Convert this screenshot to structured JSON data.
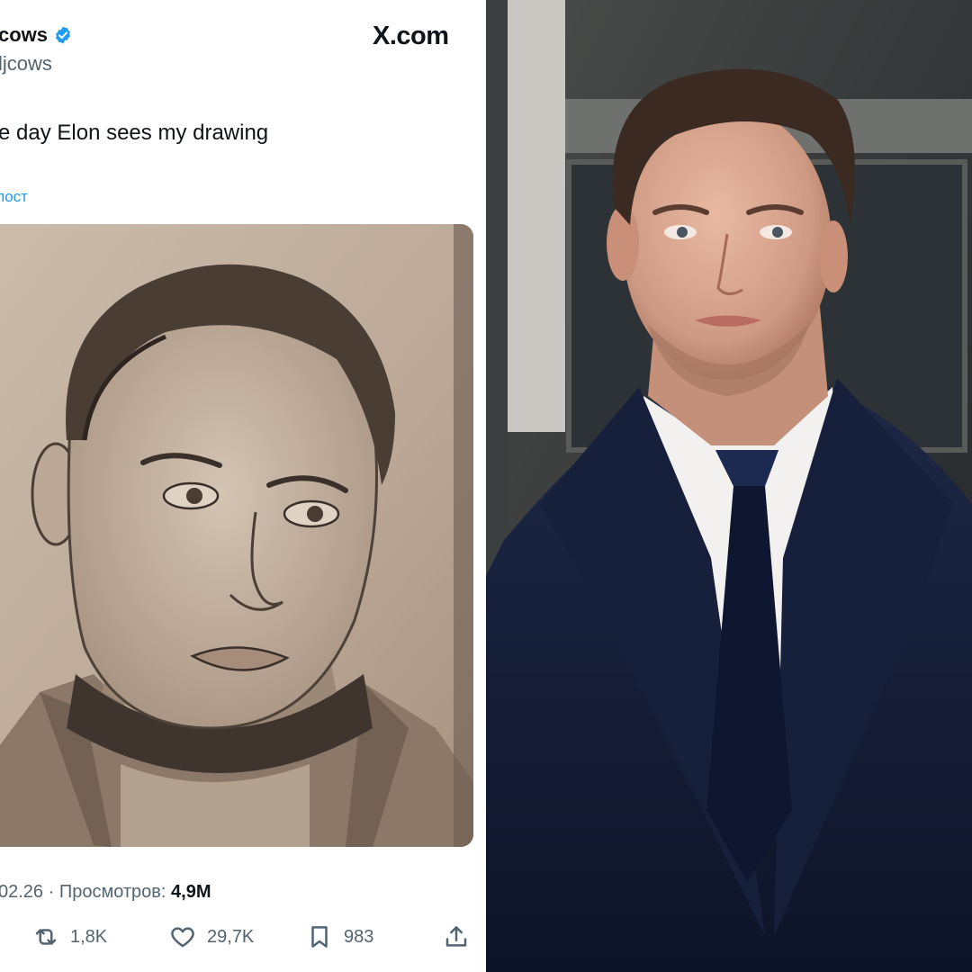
{
  "tweet": {
    "display_name": "cows",
    "handle": "ljcows",
    "brand": "X.com",
    "text": "e day Elon sees my drawing",
    "translate_link": "пост",
    "image_description_icon": "pencil-portrait-drawing",
    "meta": {
      "date": "02.26",
      "separator": " · ",
      "views_label": "Просмотров: ",
      "views_value": "4,9M"
    },
    "actions": {
      "retweets": "1,8K",
      "likes": "29,7K",
      "bookmarks": "983"
    },
    "icons": {
      "verified": "verified-badge-icon",
      "retweet": "retweet-icon",
      "like": "heart-icon",
      "bookmark": "bookmark-icon",
      "share": "share-icon"
    },
    "colors": {
      "accent": "#1d9bf0",
      "text": "#0f1419",
      "muted": "#536471"
    }
  },
  "photo": {
    "subject": "man-in-navy-suit-photo"
  }
}
